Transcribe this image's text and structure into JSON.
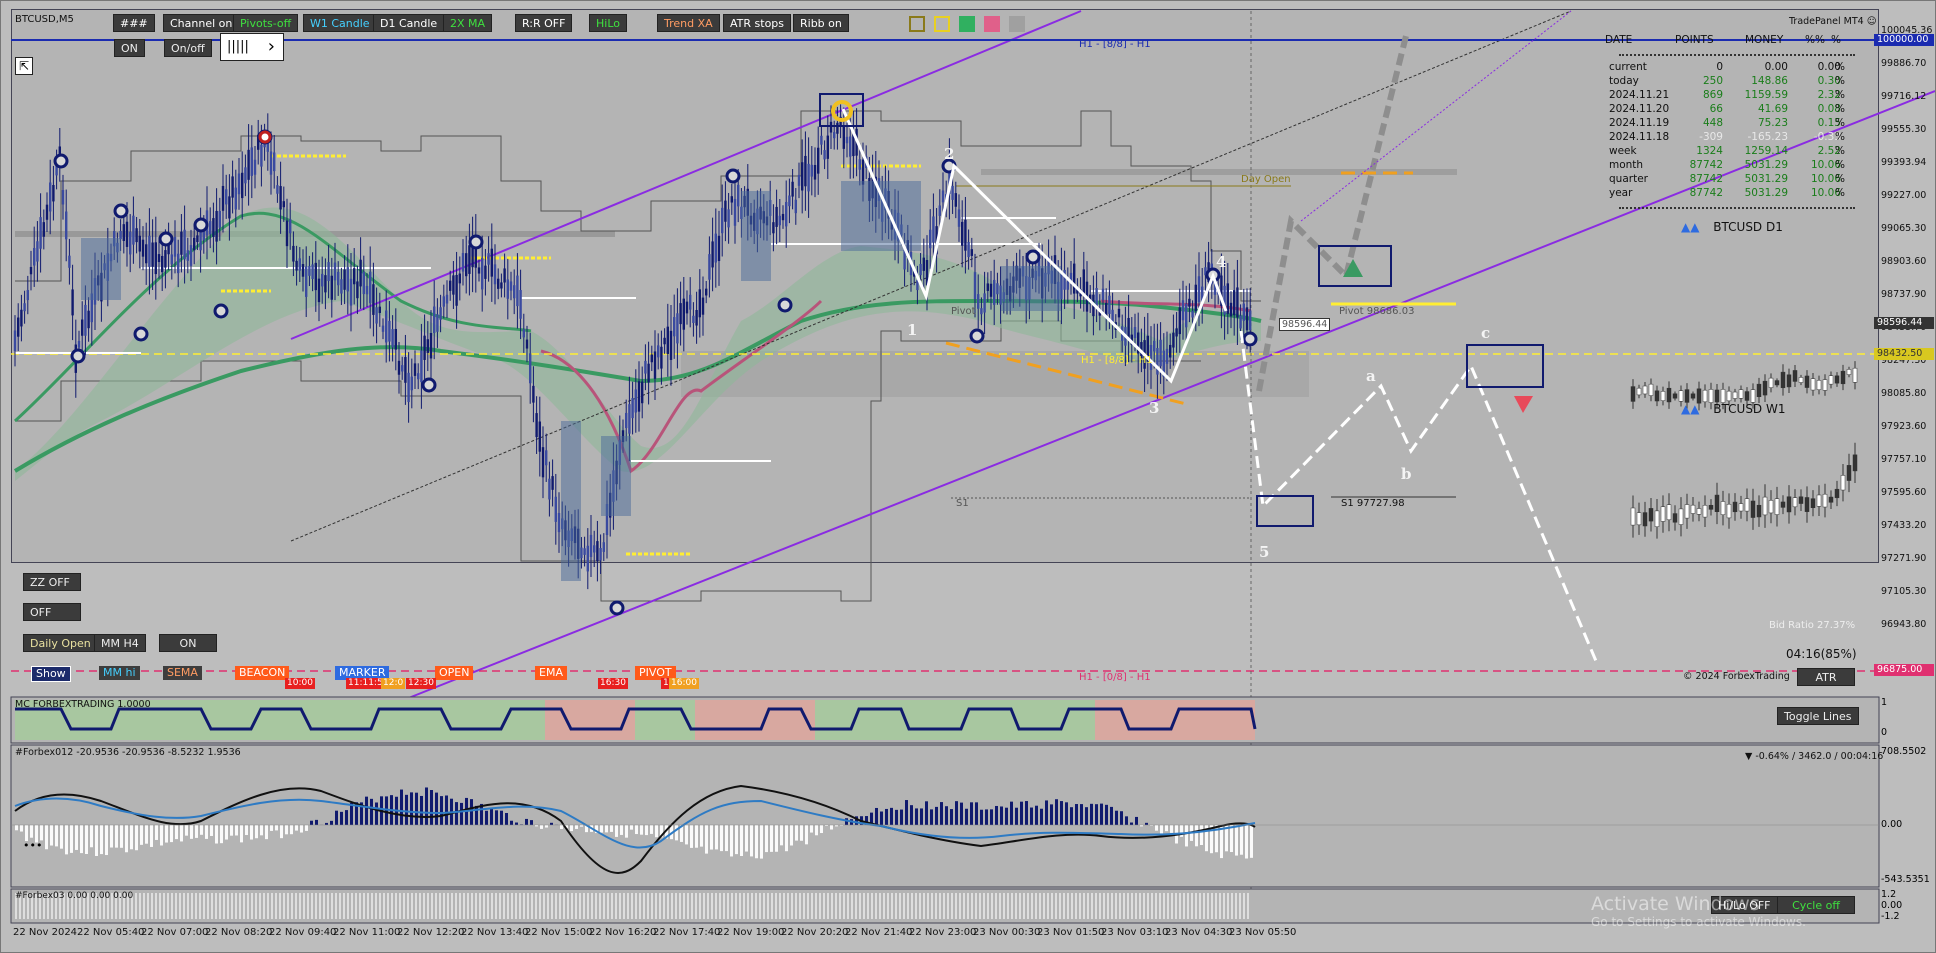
{
  "symbol": "BTCUSD,M5",
  "top_buttons": [
    {
      "label": "###",
      "color": "#ffffff",
      "bg": "#3b3b3b"
    },
    {
      "label": "Channel on",
      "color": "#ffffff",
      "bg": "#3b3b3b"
    },
    {
      "label": "Pivots-off",
      "color": "#3fe03f",
      "bg": "#3b3b3b"
    },
    {
      "label": "W1 Candle",
      "color": "#45d0ff",
      "bg": "#3b3b3b"
    },
    {
      "label": "D1 Candle",
      "color": "#ffffff",
      "bg": "#3b3b3b"
    },
    {
      "label": "2X MA",
      "color": "#3fe03f",
      "bg": "#3b3b3b"
    },
    {
      "label": "R:R OFF",
      "color": "#ffffff",
      "bg": "#3b3b3b"
    },
    {
      "label": "HiLo",
      "color": "#3fe03f",
      "bg": "#3b3b3b"
    },
    {
      "label": "Trend XA",
      "color": "#ff9c63",
      "bg": "#3b3b3b"
    },
    {
      "label": "ATR stops",
      "color": "#ffffff",
      "bg": "#3b3b3b"
    },
    {
      "label": "Ribb on",
      "color": "#ffffff",
      "bg": "#3b3b3b"
    }
  ],
  "row2_buttons": {
    "on": "ON",
    "onoff": "On/off",
    "bars": "|||||"
  },
  "tradepanel_title": "TradePanel MT4",
  "stats": {
    "headers": [
      "DATE",
      "POINTS",
      "MONEY",
      "%%",
      "%"
    ],
    "rows": [
      {
        "date": "current",
        "points": "0",
        "money": "0.00",
        "pct": "0.00",
        "color": "#111111"
      },
      {
        "date": "today",
        "points": "250",
        "money": "148.86",
        "pct": "0.30",
        "color": "#1a7d1a"
      },
      {
        "date": "2024.11.21",
        "points": "869",
        "money": "1159.59",
        "pct": "2.32",
        "color": "#1a7d1a"
      },
      {
        "date": "2024.11.20",
        "points": "66",
        "money": "41.69",
        "pct": "0.08",
        "color": "#1a7d1a"
      },
      {
        "date": "2024.11.19",
        "points": "448",
        "money": "75.23",
        "pct": "0.15",
        "color": "#1a7d1a"
      },
      {
        "date": "2024.11.18",
        "points": "-309",
        "money": "-165.23",
        "pct": "-0.33",
        "color": "#e8e8e8"
      },
      {
        "date": "week",
        "points": "1324",
        "money": "1259.14",
        "pct": "2.52",
        "color": "#1a7d1a"
      },
      {
        "date": "month",
        "points": "87742",
        "money": "5031.29",
        "pct": "10.06",
        "color": "#1a7d1a"
      },
      {
        "date": "quarter",
        "points": "87742",
        "money": "5031.29",
        "pct": "10.06",
        "color": "#1a7d1a"
      },
      {
        "date": "year",
        "points": "87742",
        "money": "5031.29",
        "pct": "10.06",
        "color": "#1a7d1a"
      }
    ]
  },
  "mini_charts": {
    "d1": "BTCUSD D1",
    "w1": "BTCUSD W1"
  },
  "price_axis": [
    "100045.36",
    "99886.70",
    "99716.12",
    "99555.30",
    "99393.94",
    "99227.00",
    "99065.30",
    "98903.60",
    "98737.90",
    "98433.70",
    "98247.30",
    "98085.80",
    "97923.60",
    "97757.10",
    "97595.60",
    "97433.20",
    "97271.90",
    "97105.30",
    "96943.80"
  ],
  "price_badges": {
    "top": "100000.00",
    "current": "98596.44",
    "level": "98432.50",
    "low": "96875.00"
  },
  "chart_labels": {
    "h1_top": "H1 - [8/8] - H1",
    "h1_mid": "H1 - [8/8] - H1",
    "h1_bottom": "H1 - [0/8] - H1",
    "day_open": "Day Open",
    "pivot": "Pivot 98686.03",
    "pivot_left": "Pivot",
    "s1": "S1 97727.98",
    "s1_left": "S1",
    "price_box": "98596.44",
    "waves": [
      "1",
      "2",
      "3",
      "4",
      "5",
      "a",
      "b",
      "c"
    ]
  },
  "bid_ratio": "Bid Ratio 27.37%",
  "timer": "04:16(85%)",
  "copyright": "© 2024 ForbexTrading",
  "atr": "ATR",
  "left_buttons": {
    "zz": "ZZ OFF",
    "off": "OFF",
    "daily": "Daily Open",
    "mm": "MM H4",
    "on": "ON"
  },
  "bottom_tags": [
    {
      "label": "Show",
      "bg": "#1c2b6b",
      "color": "#ffffff"
    },
    {
      "label": "MM hi",
      "bg": "#3d3d3d",
      "color": "#45d0ff"
    },
    {
      "label": "SEMA",
      "bg": "#3d3d3d",
      "color": "#ff9c63"
    },
    {
      "label": "BEACON",
      "bg": "#ff5a1a",
      "color": "#ffffff"
    },
    {
      "label": "MARKER",
      "bg": "#2e6be0",
      "color": "#ffffff"
    },
    {
      "label": "OPEN",
      "bg": "#ff5a1a",
      "color": "#ffffff"
    },
    {
      "label": "EMA",
      "bg": "#ff5a1a",
      "color": "#ffffff"
    },
    {
      "label": "PIVOT",
      "bg": "#ff5a1a",
      "color": "#ffffff"
    }
  ],
  "bottom_times": [
    "10:00",
    "11:11:50",
    "12:0",
    "12:30",
    "16:30",
    "14",
    "16:00"
  ],
  "indicator1": {
    "label": "MC FORBEXTRADING 1.0000",
    "button": "Toggle Lines",
    "axis": [
      "1",
      "0"
    ]
  },
  "indicator2": {
    "label": "#Forbex012 -20.9536 -20.9536 -8.5232 1.9536",
    "right": "▼ -0.64% / 3462.0 / 00:04:16",
    "axis": [
      "708.5502",
      "0.00",
      "-543.5351"
    ]
  },
  "indicator3": {
    "label": "#Forbex03 0.00 0.00 0.00",
    "axis": [
      "1.2",
      "0.00",
      "-1.2"
    ],
    "hilo": "Hi/Lo OFF",
    "cycle": "Cycle off"
  },
  "watermark": {
    "line1": "Activate Windows",
    "line2": "Go to Settings to activate Windows."
  },
  "time_axis": [
    "22 Nov 2024",
    "22 Nov 05:40",
    "22 Nov 07:00",
    "22 Nov 08:20",
    "22 Nov 09:40",
    "22 Nov 11:00",
    "22 Nov 12:20",
    "22 Nov 13:40",
    "22 Nov 15:00",
    "22 Nov 16:20",
    "22 Nov 17:40",
    "22 Nov 19:00",
    "22 Nov 20:20",
    "22 Nov 21:40",
    "22 Nov 23:00",
    "23 Nov 00:30",
    "23 Nov 01:50",
    "23 Nov 03:10",
    "23 Nov 04:30",
    "23 Nov 05:50"
  ],
  "colors": {
    "bg": "#b4b4b4",
    "candle": "#101a6e",
    "channel": "#8a2be2",
    "ema_green": "#3a9a62",
    "pink": "#b8547a",
    "yellow": "#ffee33",
    "dashed_white": "#ffffff",
    "orange": "#f0a020"
  }
}
